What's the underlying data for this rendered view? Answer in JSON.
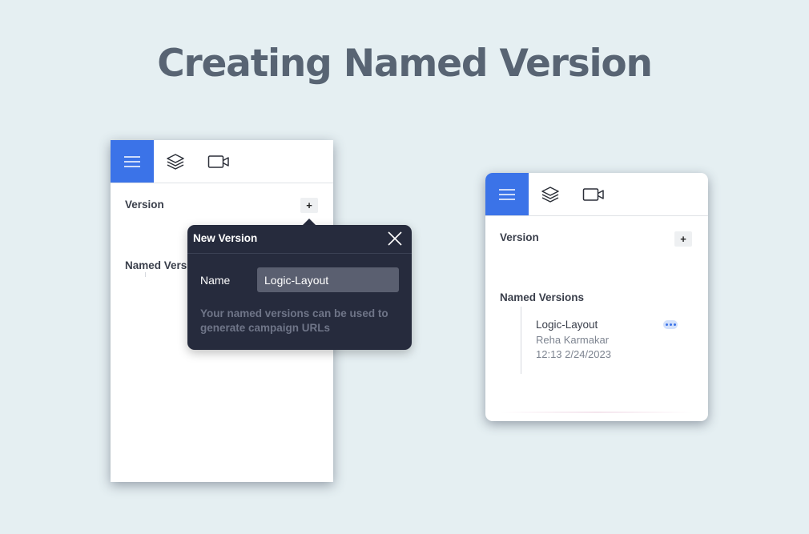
{
  "page": {
    "title": "Creating Named Version"
  },
  "left_panel": {
    "toolbar": {
      "items": [
        {
          "icon": "menu-icon",
          "active": true
        },
        {
          "icon": "layers-icon",
          "active": false
        },
        {
          "icon": "video-icon",
          "active": false
        }
      ]
    },
    "version_label": "Version",
    "add_label": "+",
    "named_versions_label": "Named Vers"
  },
  "dialog": {
    "title": "New Version",
    "name_label": "Name",
    "name_value": "Logic-Layout",
    "help_text": "Your named versions can be used to generate campaign URLs"
  },
  "right_panel": {
    "toolbar": {
      "items": [
        {
          "icon": "menu-icon",
          "active": true
        },
        {
          "icon": "layers-icon",
          "active": false
        },
        {
          "icon": "video-icon",
          "active": false
        }
      ]
    },
    "version_label": "Version",
    "add_label": "+",
    "named_versions_label": "Named Versions",
    "versions": [
      {
        "name": "Logic-Layout",
        "author": "Reha Karmakar",
        "timestamp": "12:13 2/24/2023"
      }
    ]
  },
  "colors": {
    "background": "#e5eff2",
    "accent": "#3b73e8",
    "dialog_bg": "#262b3d",
    "title": "#586473"
  }
}
